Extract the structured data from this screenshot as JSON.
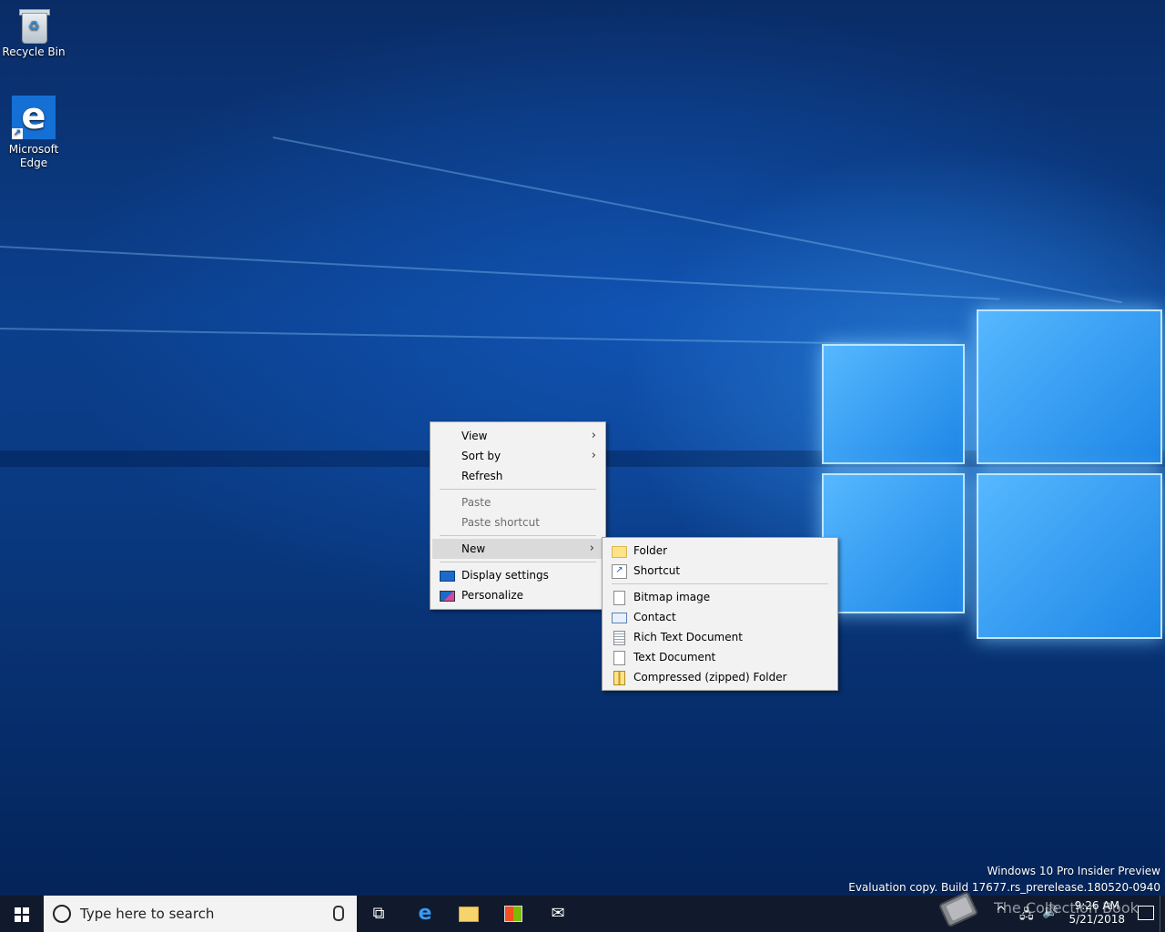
{
  "desktop": {
    "icons": [
      {
        "label": "Recycle Bin",
        "icon": "recycle-bin-icon"
      },
      {
        "label": "Microsoft Edge",
        "icon": "edge-icon"
      }
    ],
    "watermark_line1": "Windows 10 Pro Insider Preview",
    "watermark_line2": "Evaluation copy. Build 17677.rs_prerelease.180520-0940"
  },
  "context_menu": {
    "view": "View",
    "sort_by": "Sort by",
    "refresh": "Refresh",
    "paste": "Paste",
    "paste_shortcut": "Paste shortcut",
    "new": "New",
    "display_settings": "Display settings",
    "personalize": "Personalize"
  },
  "new_submenu": {
    "folder": "Folder",
    "shortcut": "Shortcut",
    "bitmap": "Bitmap image",
    "contact": "Contact",
    "rtf": "Rich Text Document",
    "text": "Text Document",
    "zip": "Compressed (zipped) Folder"
  },
  "taskbar": {
    "search_placeholder": "Type here to search",
    "pinned": [
      "task-view-icon",
      "edge-icon",
      "file-explorer-icon",
      "store-icon",
      "mail-icon"
    ],
    "time": "9:26 AM",
    "date": "5/21/2018",
    "watermark_text": "The Collection Book"
  },
  "colors": {
    "taskbar": "#101a2c",
    "menu_bg": "#f2f2f2",
    "accent": "#1570d6"
  }
}
